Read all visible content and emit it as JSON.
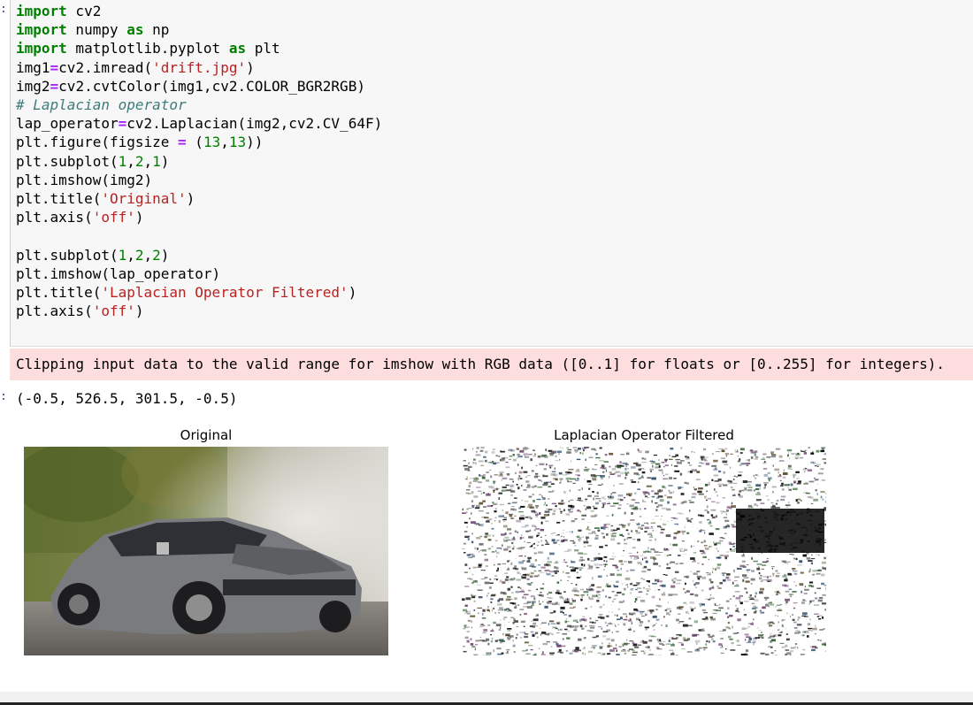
{
  "code_cell": {
    "lines": [
      "import cv2",
      "import numpy as np",
      "import matplotlib.pyplot as plt",
      "img1=cv2.imread('drift.jpg')",
      "img2=cv2.cvtColor(img1,cv2.COLOR_BGR2RGB)",
      "# Laplacian operator",
      "lap_operator=cv2.Laplacian(img2,cv2.CV_64F)",
      "plt.figure(figsize = (13,13))",
      "plt.subplot(1,2,1)",
      "plt.imshow(img2)",
      "plt.title('Original')",
      "plt.axis('off')",
      "",
      "plt.subplot(1,2,2)",
      "plt.imshow(lap_operator)",
      "plt.title('Laplacian Operator Filtered')",
      "plt.axis('off')"
    ]
  },
  "stderr_output": "Clipping input data to the valid range for imshow with RGB data ([0..1] for floats or [0..255] for integers).",
  "result_output": "(-0.5, 526.5, 301.5, -0.5)",
  "plots": {
    "left_title": "Original",
    "right_title": "Laplacian Operator Filtered"
  },
  "gutter_marks": [
    ":",
    ":"
  ],
  "colors": {
    "keyword": "#008000",
    "string": "#ba2121",
    "number": "#008000",
    "operator": "#aa22ff",
    "comment": "#3d7b7b",
    "stderr_bg": "#fddddd",
    "cell_bg": "#f7f7f7"
  }
}
